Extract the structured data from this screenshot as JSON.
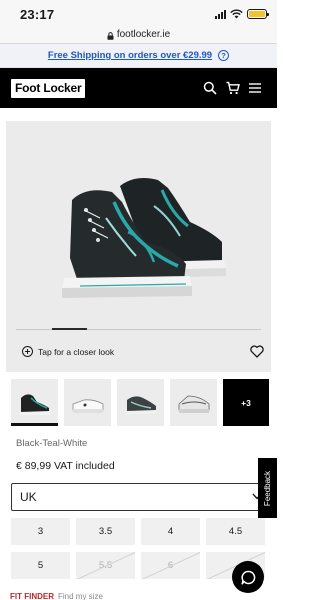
{
  "status_bar": {
    "time": "23:17"
  },
  "browser": {
    "url": "footlocker.ie"
  },
  "promo": {
    "text": "Free Shipping on orders over €29.99"
  },
  "header": {
    "logo": "Foot Locker"
  },
  "gallery": {
    "closer_look": "Tap for a closer look",
    "active_slide": 2
  },
  "thumbnails": {
    "count_visible": 4,
    "more_label": "+3"
  },
  "product": {
    "colour": "Black-Teal-White",
    "price": "€ 89,99 VAT included"
  },
  "size_region": {
    "selected": "UK"
  },
  "sizes": [
    {
      "label": "3",
      "available": true
    },
    {
      "label": "3.5",
      "available": true
    },
    {
      "label": "4",
      "available": true
    },
    {
      "label": "4.5",
      "available": true
    },
    {
      "label": "5",
      "available": true
    },
    {
      "label": "5.5",
      "available": false
    },
    {
      "label": "6",
      "available": false
    },
    {
      "label": "",
      "available": false
    }
  ],
  "fit_finder": {
    "label": "FIT FINDER",
    "sub": "Find my size"
  },
  "feedback": {
    "label": "Feedback"
  },
  "icons": [
    "lock-icon",
    "help-icon",
    "search-icon",
    "cart-icon",
    "menu-icon",
    "zoom-plus-icon",
    "heart-icon",
    "chevron-down-icon",
    "chat-icon"
  ],
  "colors": {
    "brand": "#000000",
    "promo_link": "#1e57c5",
    "fit_finder": "#c0262d",
    "shoe_accent": "#2aa7a8"
  }
}
